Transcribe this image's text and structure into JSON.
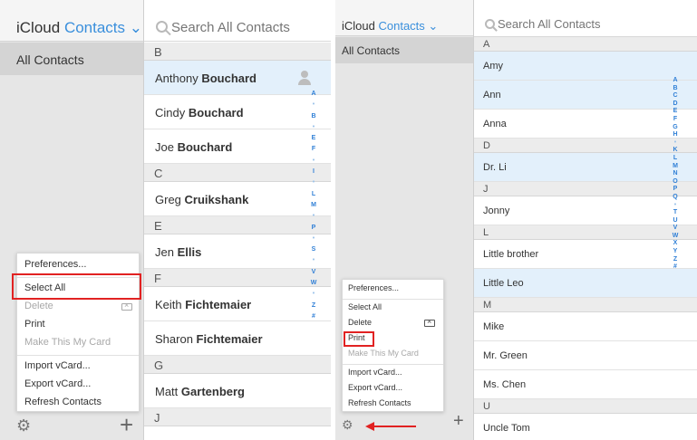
{
  "left": {
    "brand": {
      "prefix": "iCloud",
      "app": "Contacts",
      "chevron": "⌄"
    },
    "group": "All Contacts",
    "search_placeholder": "Search All Contacts",
    "rows": [
      {
        "type": "section",
        "letter": "B"
      },
      {
        "type": "contact",
        "first": "Anthony",
        "last": "Bouchard",
        "selected": true,
        "icon": "person-icon"
      },
      {
        "type": "contact",
        "first": "Cindy",
        "last": "Bouchard",
        "selected": false
      },
      {
        "type": "contact",
        "first": "Joe",
        "last": "Bouchard",
        "selected": false
      },
      {
        "type": "section",
        "letter": "C"
      },
      {
        "type": "contact",
        "first": "Greg",
        "last": "Cruikshank",
        "selected": false
      },
      {
        "type": "section",
        "letter": "E"
      },
      {
        "type": "contact",
        "first": "Jen",
        "last": "Ellis",
        "selected": false
      },
      {
        "type": "section",
        "letter": "F"
      },
      {
        "type": "contact",
        "first": "Keith",
        "last": "Fichtemaier",
        "selected": false
      },
      {
        "type": "contact",
        "first": "Sharon",
        "last": "Fichtemaier",
        "selected": false
      },
      {
        "type": "section",
        "letter": "G"
      },
      {
        "type": "contact",
        "first": "Matt",
        "last": "Gartenberg",
        "selected": false
      },
      {
        "type": "section",
        "letter": "J"
      }
    ],
    "index": [
      "A",
      "•",
      "B",
      "•",
      "E",
      "F",
      "•",
      "I",
      "•",
      "L",
      "M",
      "•",
      "P",
      "•",
      "S",
      "•",
      "V",
      "W",
      "•",
      "Z",
      "#"
    ],
    "menu": {
      "items": [
        {
          "label": "Preferences...",
          "disabled": false
        },
        {
          "sep": true
        },
        {
          "label": "Select All",
          "disabled": false
        },
        {
          "label": "Delete",
          "disabled": true,
          "icon": "delete-key-icon"
        },
        {
          "label": "Print",
          "disabled": false
        },
        {
          "label": "Make This My Card",
          "disabled": true
        },
        {
          "sep": true
        },
        {
          "label": "Import vCard...",
          "disabled": false
        },
        {
          "label": "Export vCard...",
          "disabled": false
        },
        {
          "label": "Refresh Contacts",
          "disabled": false
        }
      ]
    },
    "gear_icon": "⚙",
    "add_icon": "+"
  },
  "right": {
    "brand": {
      "prefix": "iCloud",
      "app": "Contacts",
      "chevron": "⌄"
    },
    "group": "All Contacts",
    "search_placeholder": "Search All Contacts",
    "rows": [
      {
        "type": "section",
        "letter": "A"
      },
      {
        "type": "contact",
        "first": "Amy",
        "last": "",
        "selected": true
      },
      {
        "type": "contact",
        "first": "Ann",
        "last": "",
        "selected": true
      },
      {
        "type": "contact",
        "first": "Anna",
        "last": "",
        "selected": false
      },
      {
        "type": "section",
        "letter": "D"
      },
      {
        "type": "contact",
        "first": "Dr. Li",
        "last": "",
        "selected": true
      },
      {
        "type": "section",
        "letter": "J"
      },
      {
        "type": "contact",
        "first": "Jonny",
        "last": "",
        "selected": false
      },
      {
        "type": "section",
        "letter": "L"
      },
      {
        "type": "contact",
        "first": "Little brother",
        "last": "",
        "selected": false
      },
      {
        "type": "contact",
        "first": "Little Leo",
        "last": "",
        "selected": true
      },
      {
        "type": "section",
        "letter": "M"
      },
      {
        "type": "contact",
        "first": "Mike",
        "last": "",
        "selected": false
      },
      {
        "type": "contact",
        "first": "Mr. Green",
        "last": "",
        "selected": false
      },
      {
        "type": "contact",
        "first": "Ms. Chen",
        "last": "",
        "selected": false
      },
      {
        "type": "section",
        "letter": "U"
      },
      {
        "type": "contact",
        "first": "Uncle Tom",
        "last": "",
        "selected": false
      }
    ],
    "index": [
      "A",
      "B",
      "C",
      "D",
      "E",
      "F",
      "G",
      "H",
      "•",
      "K",
      "L",
      "M",
      "N",
      "O",
      "P",
      "Q",
      "•",
      "T",
      "U",
      "V",
      "W",
      "X",
      "Y",
      "Z",
      "#"
    ],
    "menu": {
      "items": [
        {
          "label": "Preferences...",
          "disabled": false
        },
        {
          "sep": true
        },
        {
          "label": "Select All",
          "disabled": false
        },
        {
          "label": "Delete",
          "disabled": false,
          "icon": "delete-key-icon"
        },
        {
          "label": "Print",
          "disabled": false
        },
        {
          "label": "Make This My Card",
          "disabled": true
        },
        {
          "sep": true
        },
        {
          "label": "Import vCard...",
          "disabled": false
        },
        {
          "label": "Export vCard...",
          "disabled": false
        },
        {
          "label": "Refresh Contacts",
          "disabled": false
        }
      ]
    },
    "gear_icon": "⚙",
    "add_icon": "+"
  },
  "colors": {
    "accent": "#3a8fdc",
    "selected_row": "#e3f0fb",
    "highlight": "#e12222",
    "sidebar": "#e6e6e6"
  }
}
